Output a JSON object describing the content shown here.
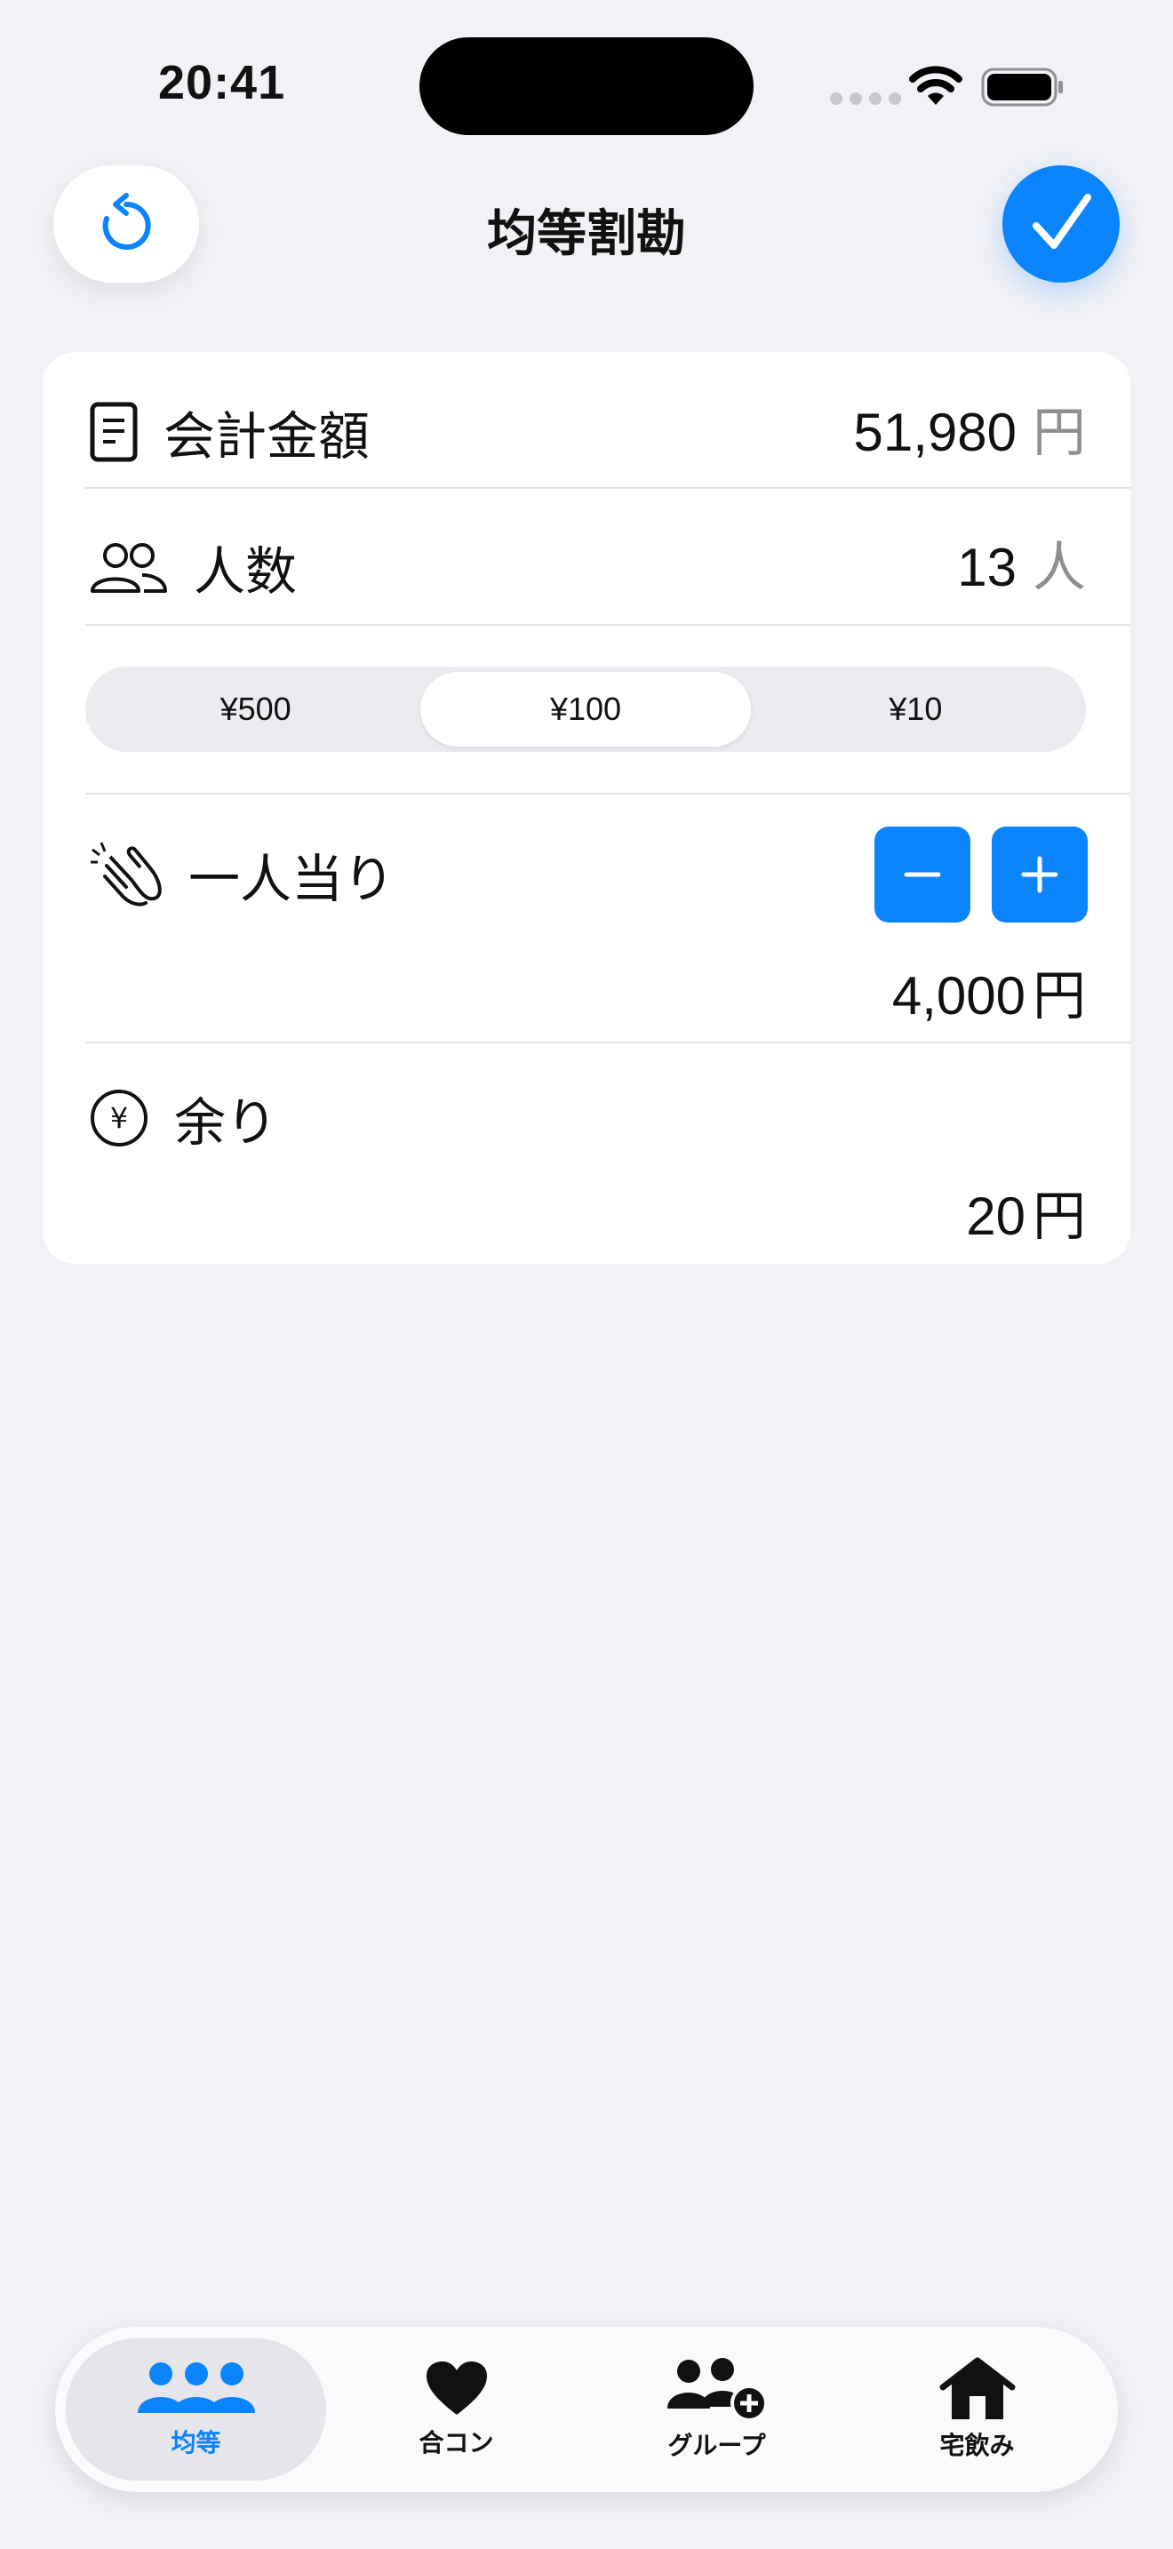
{
  "status_bar": {
    "time": "20:41"
  },
  "header": {
    "title": "均等割勘"
  },
  "total": {
    "label": "会計金額",
    "value": "51,980",
    "unit": "円"
  },
  "people": {
    "label": "人数",
    "value": "13",
    "unit": "人"
  },
  "rounding": {
    "options": [
      "¥500",
      "¥100",
      "¥10"
    ],
    "selected": "¥100"
  },
  "per_person": {
    "label": "一人当り",
    "value": "4,000",
    "unit": "円"
  },
  "remainder": {
    "label": "余り",
    "value": "20",
    "unit": "円"
  },
  "tabs": [
    {
      "label": "均等",
      "icon": "three-people-icon",
      "active": true
    },
    {
      "label": "合コン",
      "icon": "heart-icon",
      "active": false
    },
    {
      "label": "グループ",
      "icon": "group-add-icon",
      "active": false
    },
    {
      "label": "宅飲み",
      "icon": "house-icon",
      "active": false
    }
  ],
  "colors": {
    "accent": "#0A84FF",
    "background": "#F1F1F6",
    "muted": "#8E8E93"
  }
}
